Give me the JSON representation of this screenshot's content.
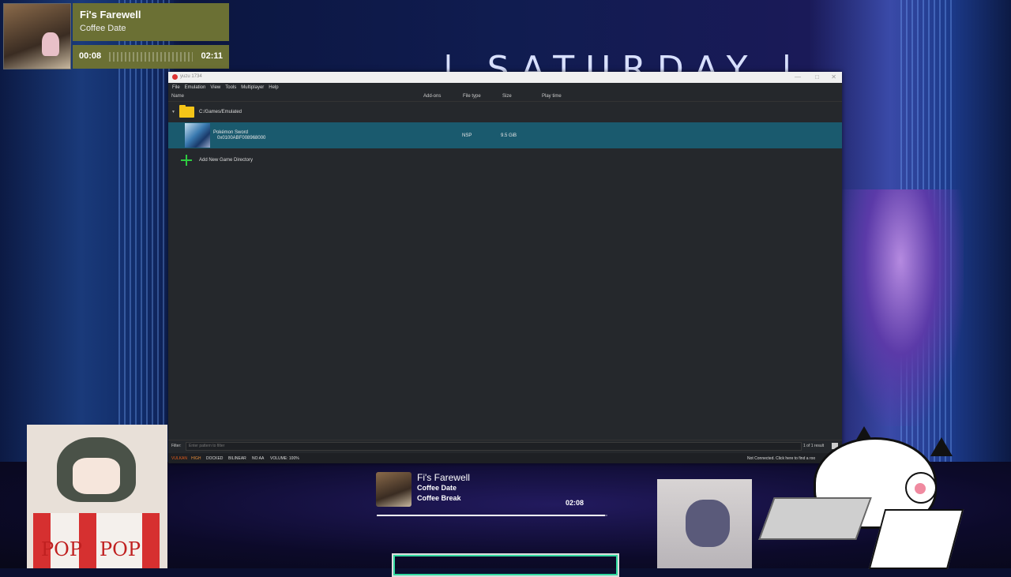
{
  "overlay": {
    "now_playing": {
      "title": "Fi's Farewell",
      "subtitle": "Coffee Date",
      "current_time": "00:08",
      "total_time": "02:11"
    },
    "banner_text": "| SATURDAY |",
    "bottom_player": {
      "title": "Fi's Farewell",
      "line1": "Coffee Date",
      "line2": "Coffee Break",
      "time": "02:08",
      "progress": 0.99
    },
    "popcorn_text_left": "POP",
    "popcorn_text_right": "POP"
  },
  "window": {
    "title": "yuzu 1734",
    "controls": [
      "—",
      "□",
      "✕"
    ],
    "menu": [
      "File",
      "Emulation",
      "View",
      "Tools",
      "Multiplayer",
      "Help"
    ],
    "columns": {
      "name": "Name",
      "addons": "Add-ons",
      "filetype": "File type",
      "size": "Size",
      "playtime": "Play time"
    },
    "folder": {
      "path": "C:/Games/Emulated",
      "expand_icon": "chevron-down-icon"
    },
    "game": {
      "name": "Pokémon Sword",
      "title_id": "0x0100ABF008968000",
      "filetype": "NSP",
      "size": "9.5 GiB",
      "addons": "",
      "playtime": ""
    },
    "add_directory": {
      "label": "Add New Game Directory"
    },
    "filter": {
      "label": "Filter:",
      "placeholder": "Enter pattern to filter",
      "result": "1 of 1 result"
    },
    "status": {
      "api": "VULKAN",
      "accuracy": "HIGH",
      "dock": "DOCKED",
      "filter": "BILINEAR",
      "aa": "NO AA",
      "volume": "VOLUME: 100%",
      "network": "Not Connected. Click here to find a roo"
    },
    "colors": {
      "selection": "#1a5a6e",
      "api_color": "#e05a1a",
      "background": "#25282c"
    }
  }
}
